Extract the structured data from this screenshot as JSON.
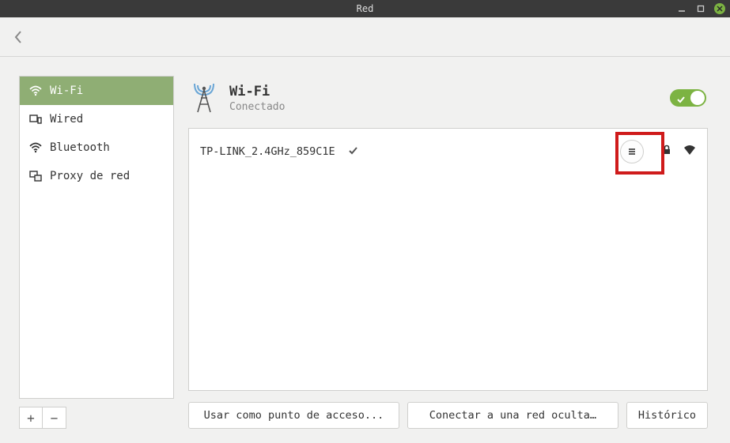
{
  "window": {
    "title": "Red"
  },
  "sidebar": {
    "items": [
      {
        "label": "Wi-Fi"
      },
      {
        "label": "Wired"
      },
      {
        "label": "Bluetooth"
      },
      {
        "label": "Proxy de red"
      }
    ]
  },
  "main": {
    "title": "Wi-Fi",
    "status": "Conectado",
    "toggle_on": true
  },
  "network": {
    "ssid": "TP-LINK_2.4GHz_859C1E"
  },
  "buttons": {
    "hotspot": "Usar como punto de acceso...",
    "hidden": "Conectar a una red oculta…",
    "history": "Histórico"
  }
}
